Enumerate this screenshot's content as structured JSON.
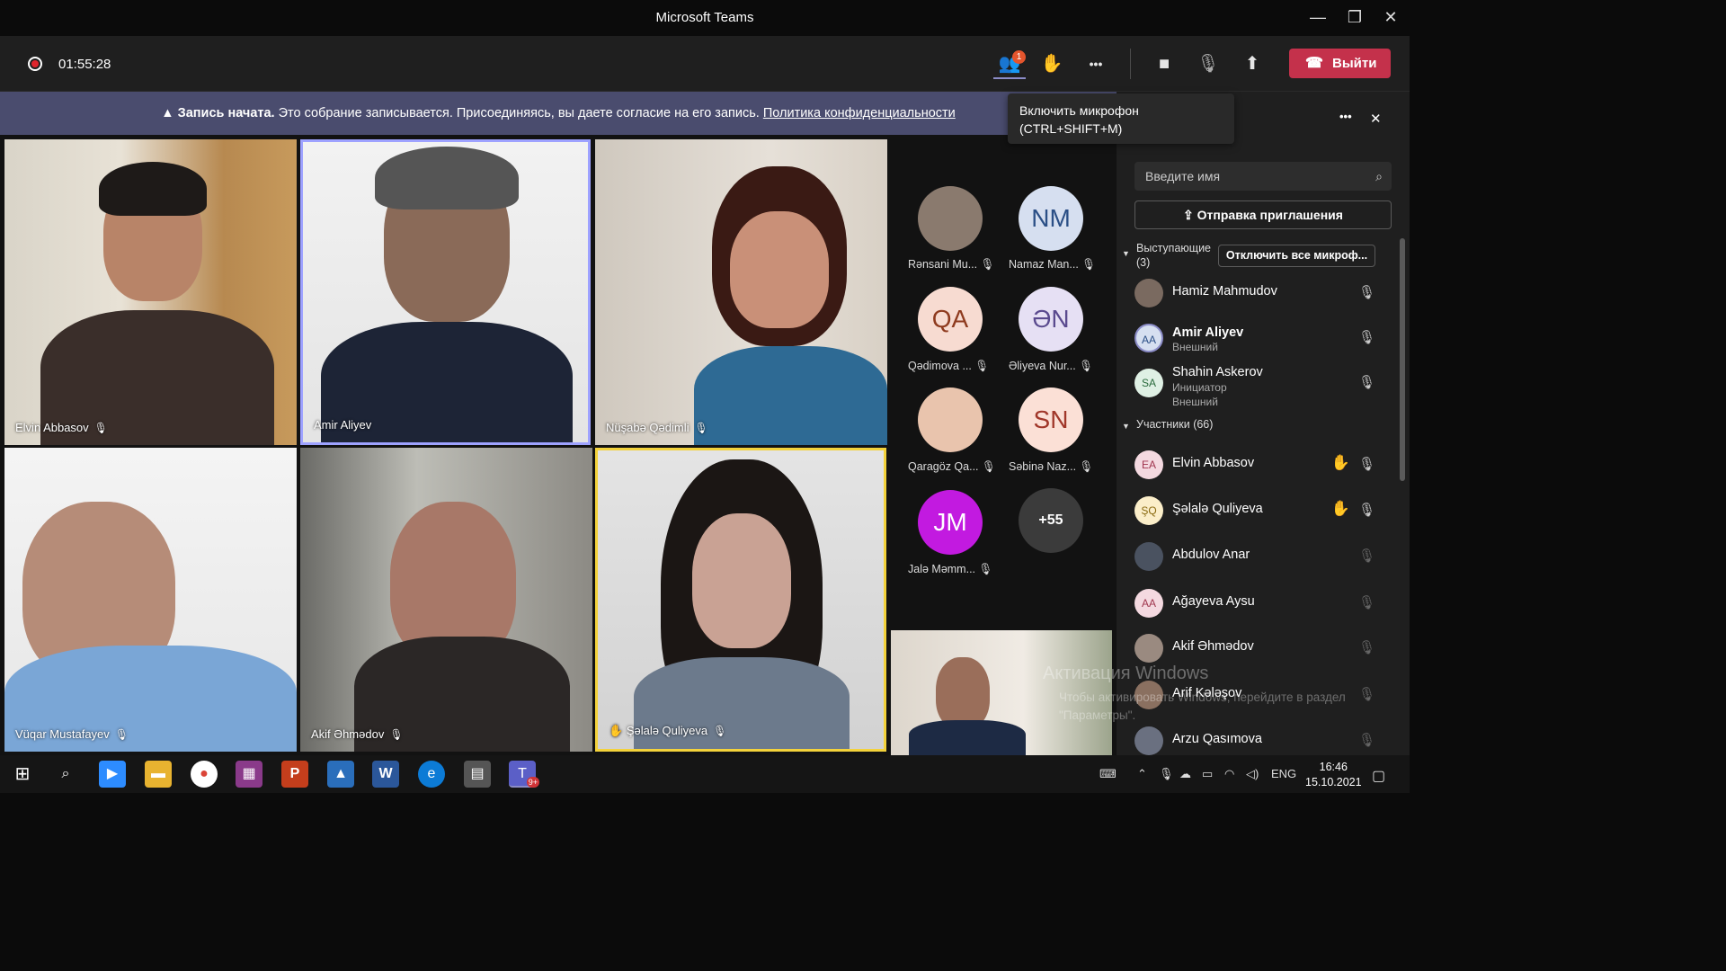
{
  "window": {
    "title": "Microsoft Teams",
    "min": "—",
    "max": "❐",
    "close": "✕"
  },
  "toolbar": {
    "timer": "01:55:28",
    "people_badge": "1",
    "people_icon": "👥",
    "react_icon": "✋",
    "more": "•••",
    "camera": "■",
    "mic": "🎙",
    "share": "⬆",
    "leave": "Выйти"
  },
  "tooltip": {
    "line1": "Включить микрофон",
    "line2": "(CTRL+SHIFT+M)"
  },
  "banner": {
    "title": "Запись начата.",
    "text": "Это собрание записывается. Присоединяясь, вы даете согласие на его запись.",
    "link": "Политика конфиденциальности"
  },
  "tiles": [
    {
      "name": "Elvin Abbasov",
      "mic": "🎙"
    },
    {
      "name": "Amir Aliyev",
      "mic": ""
    },
    {
      "name": "Nüşabə Qədimli",
      "mic": "🎙"
    },
    {
      "name": "Vüqar Mustafayev",
      "mic": "🎙"
    },
    {
      "name": "Akif Əhmədov",
      "mic": "🎙"
    },
    {
      "name": "Şəlalə Quliyeva",
      "mic": "🎙",
      "hand": "✋"
    }
  ],
  "avatars": [
    {
      "initials": "",
      "name": "Rənsani Mu..."
    },
    {
      "initials": "NM",
      "name": "Namaz Man..."
    },
    {
      "initials": "QA",
      "name": "Qədimova ..."
    },
    {
      "initials": "ƏN",
      "name": "Əliyeva Nur..."
    },
    {
      "initials": "",
      "name": "Qaragöz Qa..."
    },
    {
      "initials": "SN",
      "name": "Səbinə Naz..."
    },
    {
      "initials": "JM",
      "name": "Jalə Məmm..."
    },
    {
      "initials": "+55",
      "name": ""
    }
  ],
  "panel": {
    "more": "•••",
    "close": "✕",
    "search_placeholder": "Введите имя",
    "invite": "Отправка приглашения",
    "presenters_label": "Выступающие",
    "presenters_count": "(3)",
    "mute_all": "Отключить все микроф...",
    "participants_label": "Участники (66)",
    "presenters": [
      {
        "initials": "",
        "name": "Hamiz Mahmudov",
        "sub1": "",
        "sub2": ""
      },
      {
        "initials": "AA",
        "name": "Amir Aliyev",
        "sub1": "Внешний",
        "sub2": ""
      },
      {
        "initials": "SA",
        "name": "Shahin Askerov",
        "sub1": "Инициатор",
        "sub2": "Внешний"
      }
    ],
    "participants": [
      {
        "initials": "EA",
        "name": "Elvin Abbasov"
      },
      {
        "initials": "ŞQ",
        "name": "Şəlalə Quliyeva"
      },
      {
        "initials": "",
        "name": "Abdulov Anar"
      },
      {
        "initials": "AA",
        "name": "Ağayeva Aysu"
      },
      {
        "initials": "",
        "name": "Akif Əhmədov"
      },
      {
        "initials": "",
        "name": "Arif Kələşov"
      },
      {
        "initials": "",
        "name": "Arzu Qasımova"
      }
    ]
  },
  "watermark": {
    "title": "Активация Windows",
    "line1": "Чтобы активировать Windows, перейдите в раздел",
    "line2": "\"Параметры\"."
  },
  "taskbar": {
    "lang": "ENG",
    "time": "16:46",
    "date": "15.10.2021",
    "teams_badge": "9+"
  }
}
